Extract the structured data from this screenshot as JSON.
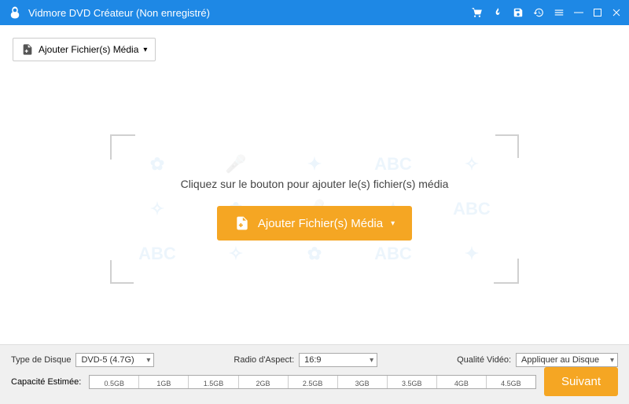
{
  "titlebar": {
    "title": "Vidmore DVD Créateur (Non enregistré)"
  },
  "toolbar": {
    "add_label": "Ajouter Fichier(s) Média"
  },
  "dropzone": {
    "hint": "Cliquez sur le bouton pour ajouter le(s) fichier(s) média",
    "add_label": "Ajouter Fichier(s) Média"
  },
  "footer": {
    "disc_type_label": "Type de Disque",
    "disc_type_value": "DVD-5 (4.7G)",
    "aspect_label": "Radio d'Aspect:",
    "aspect_value": "16:9",
    "quality_label": "Qualité Vidéo:",
    "quality_value": "Appliquer au Disque",
    "capacity_label": "Capacité Estimée:",
    "ticks": [
      "0.5GB",
      "1GB",
      "1.5GB",
      "2GB",
      "2.5GB",
      "3GB",
      "3.5GB",
      "4GB",
      "4.5GB"
    ],
    "next_label": "Suivant"
  }
}
